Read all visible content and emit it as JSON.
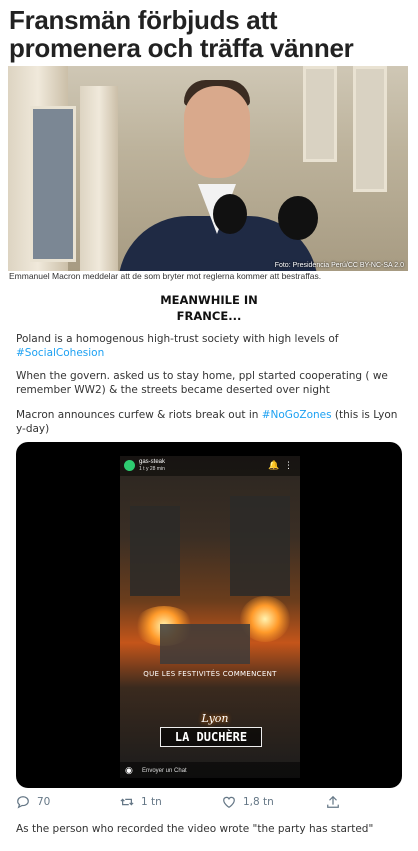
{
  "article": {
    "headline": "Fransmän förbjuds att promenera och träffa vänner",
    "photo_credit": "Foto: Presidencia Perú/CC BY-NC-SA 2.0",
    "caption": "Emmanuel Macron meddelar att de som bryter mot reglerna kommer att bestraffas."
  },
  "meme": {
    "line1": "MEANWHILE IN",
    "line2": "FRANCE..."
  },
  "tweet": {
    "p1_text": "Poland is a homogenous high-trust society with high levels of ",
    "p1_hashtag": "#SocialCohesion",
    "p2_text": "When the govern. asked us to stay home, ppl started cooperating ( we remember WW2) & the streets became deserted over night",
    "p3_text_a": "Macron announces curfew & riots break out in ",
    "p3_hashtag": "#NoGoZones",
    "p3_text_b": " (this is Lyon y-day)",
    "video": {
      "username": "gas-steak",
      "timestamp": "1 t y 28 min",
      "overlay_text": "QUE LES FESTIVITÉS COMMENCENT",
      "sticker_lyon": "Lyon",
      "sticker_duchere": "LA DUCHÈRE",
      "send_chat": "Envoyer un Chat"
    },
    "actions": {
      "replies": "70",
      "retweets": "1 tn",
      "likes": "1,8 tn"
    },
    "closing": "As the person who recorded the video wrote \"the party has started\""
  }
}
